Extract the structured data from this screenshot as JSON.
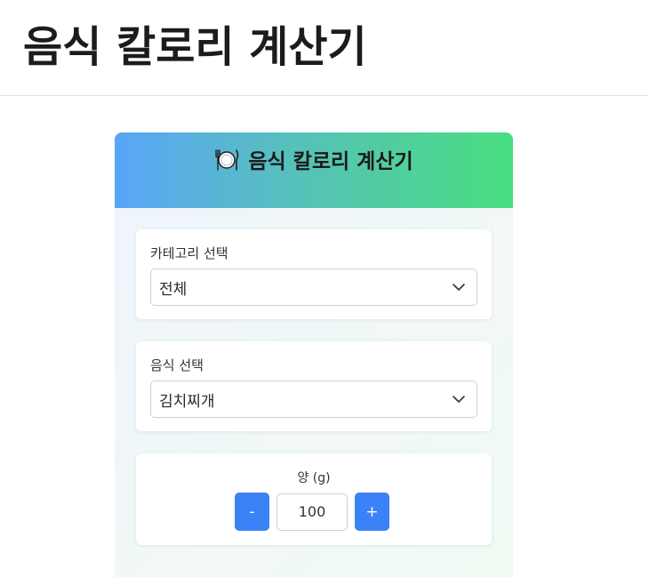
{
  "page": {
    "title": "음식 칼로리 계산기"
  },
  "card": {
    "icon": "plate-fork-knife-icon",
    "title": "음식 칼로리 계산기"
  },
  "category": {
    "label": "카테고리 선택",
    "selected": "전체"
  },
  "food": {
    "label": "음식 선택",
    "selected": "김치찌개"
  },
  "amount": {
    "label": "양 (g)",
    "value": "100",
    "decrement_label": "-",
    "increment_label": "+"
  },
  "colors": {
    "accent": "#3b82f6",
    "header_gradient_start": "#5aa5f8",
    "header_gradient_end": "#48de7f"
  }
}
